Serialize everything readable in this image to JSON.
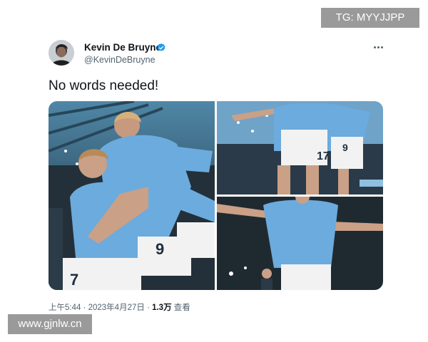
{
  "watermark": {
    "tg": "TG: MYYJJPP",
    "site": "www.gjnlw.cn"
  },
  "tweet": {
    "author": {
      "display_name": "Kevin De Bruyne",
      "handle": "@KevinDeBruyne",
      "verified": true,
      "verified_icon": "verified-badge-icon",
      "verified_color": "#1d9bf0"
    },
    "more_icon": "more-options-icon",
    "text": "No words needed!",
    "media": [
      {
        "kind": "photo",
        "description_icon": "photo-celebration"
      },
      {
        "kind": "photo",
        "description_icon": "photo-group-hug"
      },
      {
        "kind": "photo",
        "description_icon": "photo-arms-wide"
      }
    ],
    "meta": {
      "time_date": "上午5:44 · 2023年4月27日 · ",
      "views_count": "1.3万",
      "views_label": " 查看"
    }
  },
  "colors": {
    "sky_blue": "#6cabdd",
    "text_primary": "#0f1419",
    "text_secondary": "#536471",
    "watermark_bg": "#9a9a9a"
  }
}
